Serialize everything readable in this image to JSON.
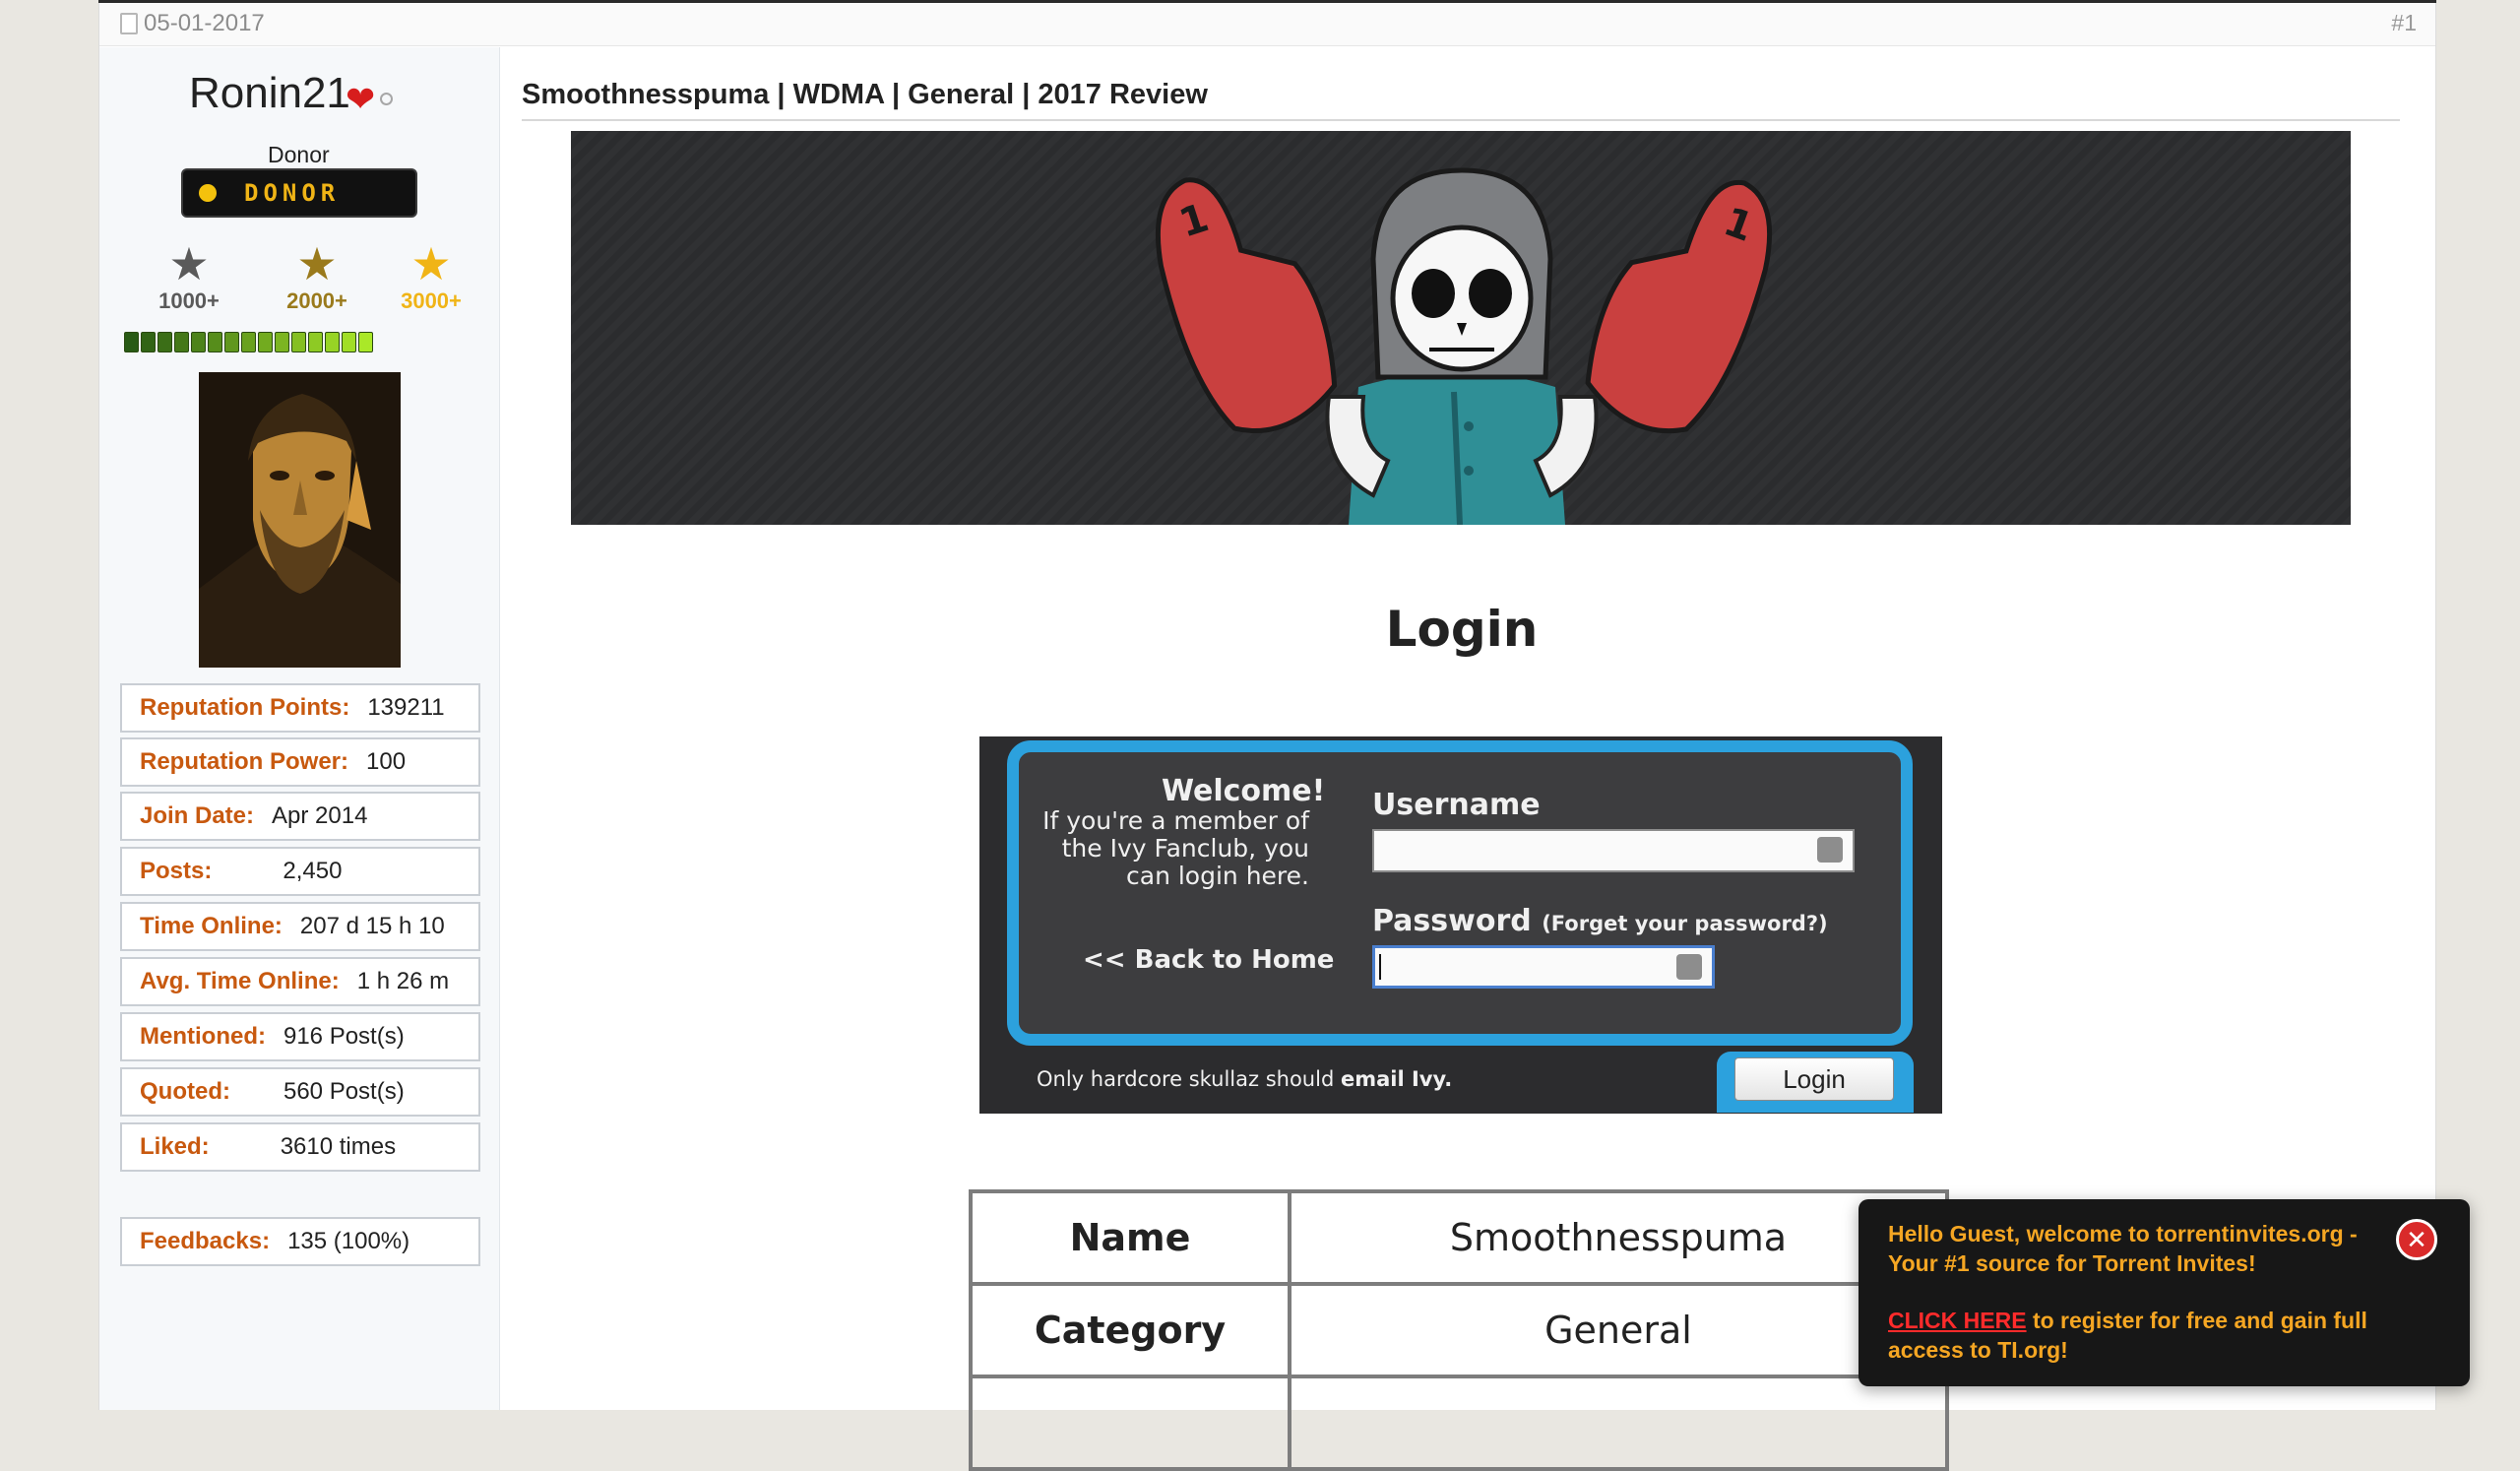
{
  "post": {
    "date": "05-01-2017",
    "number": "#1",
    "title": "Smoothnesspuma | WDMA | General | 2017 Review"
  },
  "user": {
    "name": "Ronin21",
    "title": "Donor",
    "badge": "DONOR",
    "stars": [
      {
        "label": "1000+",
        "color": "#5a5a5a"
      },
      {
        "label": "2000+",
        "color": "#9a7a1c"
      },
      {
        "label": "3000+",
        "color": "#f0b416"
      }
    ],
    "rep_level": 15,
    "stats": [
      {
        "key": "Reputation Points:",
        "value": "139211"
      },
      {
        "key": "Reputation Power:",
        "value": "100"
      },
      {
        "key": "Join Date:",
        "value": "Apr 2014"
      },
      {
        "key": "Posts:",
        "value": "2,450"
      },
      {
        "key": "Time Online:",
        "value": "207 d 15 h 10"
      },
      {
        "key": "Avg. Time Online:",
        "value": "1 h 26 m"
      },
      {
        "key": "Mentioned:",
        "value": "916 Post(s)"
      },
      {
        "key": "Quoted:",
        "value": "560 Post(s)"
      },
      {
        "key": "Liked:",
        "value": "3610 times"
      }
    ],
    "time_online_wrap": "m",
    "feedbacks": {
      "key": "Feedbacks:",
      "value": "135 (100%)"
    }
  },
  "login": {
    "heading": "Login",
    "welcome": "Welcome!",
    "welcome_lines": [
      "If you're a member of",
      "the Ivy Fanclub, you",
      "can login here."
    ],
    "back_link": "<< Back to Home",
    "username_label": "Username",
    "password_label": "Password",
    "forgot": "(Forget your password?)",
    "footer_prefix": "Only hardcore skullaz should ",
    "footer_bold": "email Ivy.",
    "button": "Login"
  },
  "info_table": [
    {
      "label": "Name",
      "value": "Smoothnesspuma"
    },
    {
      "label": "Category",
      "value": "General"
    }
  ],
  "guest_popup": {
    "message": "Hello Guest, welcome to torrentinvites.org - Your #1 source for Torrent Invites!",
    "link": "CLICK HERE",
    "message_after_link": " to register for free and gain full access to TI.org!"
  },
  "colors": {
    "accent_orange": "#c8590f",
    "login_border": "#2ca1dd",
    "popup_text": "#f5a623"
  }
}
